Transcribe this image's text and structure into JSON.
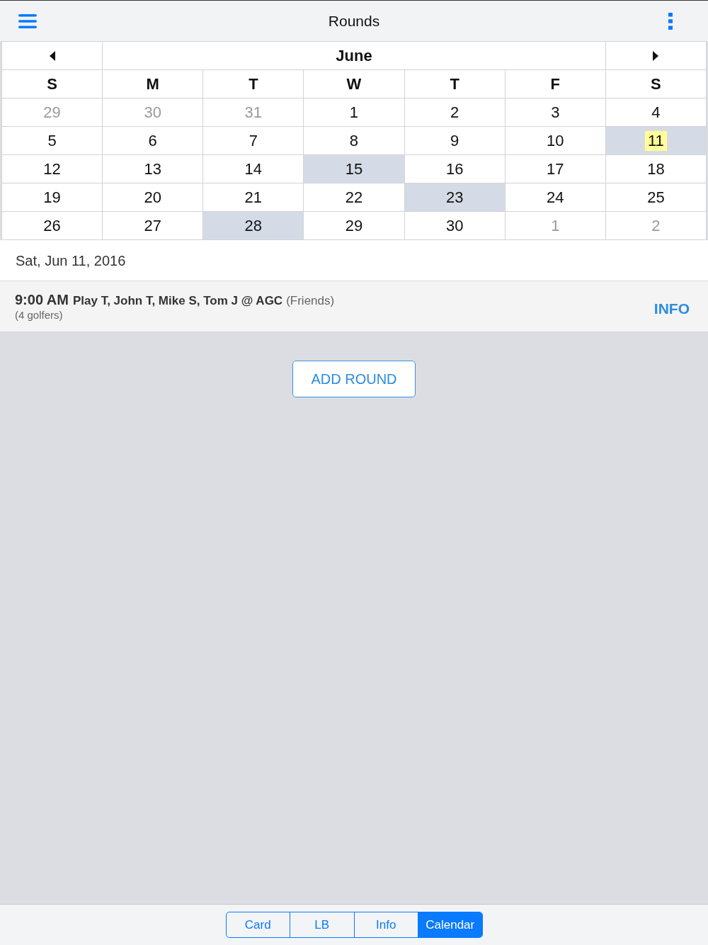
{
  "header": {
    "title": "Rounds"
  },
  "calendar": {
    "month": "June",
    "weekdays": [
      "S",
      "M",
      "T",
      "W",
      "T",
      "F",
      "S"
    ],
    "weeks": [
      {
        "days": [
          {
            "label": "29",
            "other_month": true,
            "has_round": false,
            "selected": false
          },
          {
            "label": "30",
            "other_month": true,
            "has_round": false,
            "selected": false
          },
          {
            "label": "31",
            "other_month": true,
            "has_round": false,
            "selected": false
          },
          {
            "label": "1",
            "other_month": false,
            "has_round": false,
            "selected": false
          },
          {
            "label": "2",
            "other_month": false,
            "has_round": false,
            "selected": false
          },
          {
            "label": "3",
            "other_month": false,
            "has_round": false,
            "selected": false
          },
          {
            "label": "4",
            "other_month": false,
            "has_round": false,
            "selected": false
          }
        ]
      },
      {
        "days": [
          {
            "label": "5",
            "other_month": false,
            "has_round": false,
            "selected": false
          },
          {
            "label": "6",
            "other_month": false,
            "has_round": false,
            "selected": false
          },
          {
            "label": "7",
            "other_month": false,
            "has_round": false,
            "selected": false
          },
          {
            "label": "8",
            "other_month": false,
            "has_round": false,
            "selected": false
          },
          {
            "label": "9",
            "other_month": false,
            "has_round": false,
            "selected": false
          },
          {
            "label": "10",
            "other_month": false,
            "has_round": false,
            "selected": false
          },
          {
            "label": "11",
            "other_month": false,
            "has_round": true,
            "selected": true
          }
        ]
      },
      {
        "days": [
          {
            "label": "12",
            "other_month": false,
            "has_round": false,
            "selected": false
          },
          {
            "label": "13",
            "other_month": false,
            "has_round": false,
            "selected": false
          },
          {
            "label": "14",
            "other_month": false,
            "has_round": false,
            "selected": false
          },
          {
            "label": "15",
            "other_month": false,
            "has_round": true,
            "selected": false
          },
          {
            "label": "16",
            "other_month": false,
            "has_round": false,
            "selected": false
          },
          {
            "label": "17",
            "other_month": false,
            "has_round": false,
            "selected": false
          },
          {
            "label": "18",
            "other_month": false,
            "has_round": false,
            "selected": false
          }
        ]
      },
      {
        "days": [
          {
            "label": "19",
            "other_month": false,
            "has_round": false,
            "selected": false
          },
          {
            "label": "20",
            "other_month": false,
            "has_round": false,
            "selected": false
          },
          {
            "label": "21",
            "other_month": false,
            "has_round": false,
            "selected": false
          },
          {
            "label": "22",
            "other_month": false,
            "has_round": false,
            "selected": false
          },
          {
            "label": "23",
            "other_month": false,
            "has_round": true,
            "selected": false
          },
          {
            "label": "24",
            "other_month": false,
            "has_round": false,
            "selected": false
          },
          {
            "label": "25",
            "other_month": false,
            "has_round": false,
            "selected": false
          }
        ]
      },
      {
        "days": [
          {
            "label": "26",
            "other_month": false,
            "has_round": false,
            "selected": false
          },
          {
            "label": "27",
            "other_month": false,
            "has_round": false,
            "selected": false
          },
          {
            "label": "28",
            "other_month": false,
            "has_round": true,
            "selected": false
          },
          {
            "label": "29",
            "other_month": false,
            "has_round": false,
            "selected": false
          },
          {
            "label": "30",
            "other_month": false,
            "has_round": false,
            "selected": false
          },
          {
            "label": "1",
            "other_month": true,
            "has_round": false,
            "selected": false
          },
          {
            "label": "2",
            "other_month": true,
            "has_round": false,
            "selected": false
          }
        ]
      }
    ]
  },
  "selected_date": "Sat, Jun 11, 2016",
  "rounds": [
    {
      "time": "9:00 AM",
      "players": "Play T, John T, Mike S, Tom J @ AGC",
      "group": "(Friends)",
      "golfers": "(4 golfers)",
      "action": "INFO"
    }
  ],
  "add_button": "ADD ROUND",
  "tabs": [
    {
      "label": "Card",
      "selected": false
    },
    {
      "label": "LB",
      "selected": false
    },
    {
      "label": "Info",
      "selected": false
    },
    {
      "label": "Calendar",
      "selected": true
    }
  ]
}
